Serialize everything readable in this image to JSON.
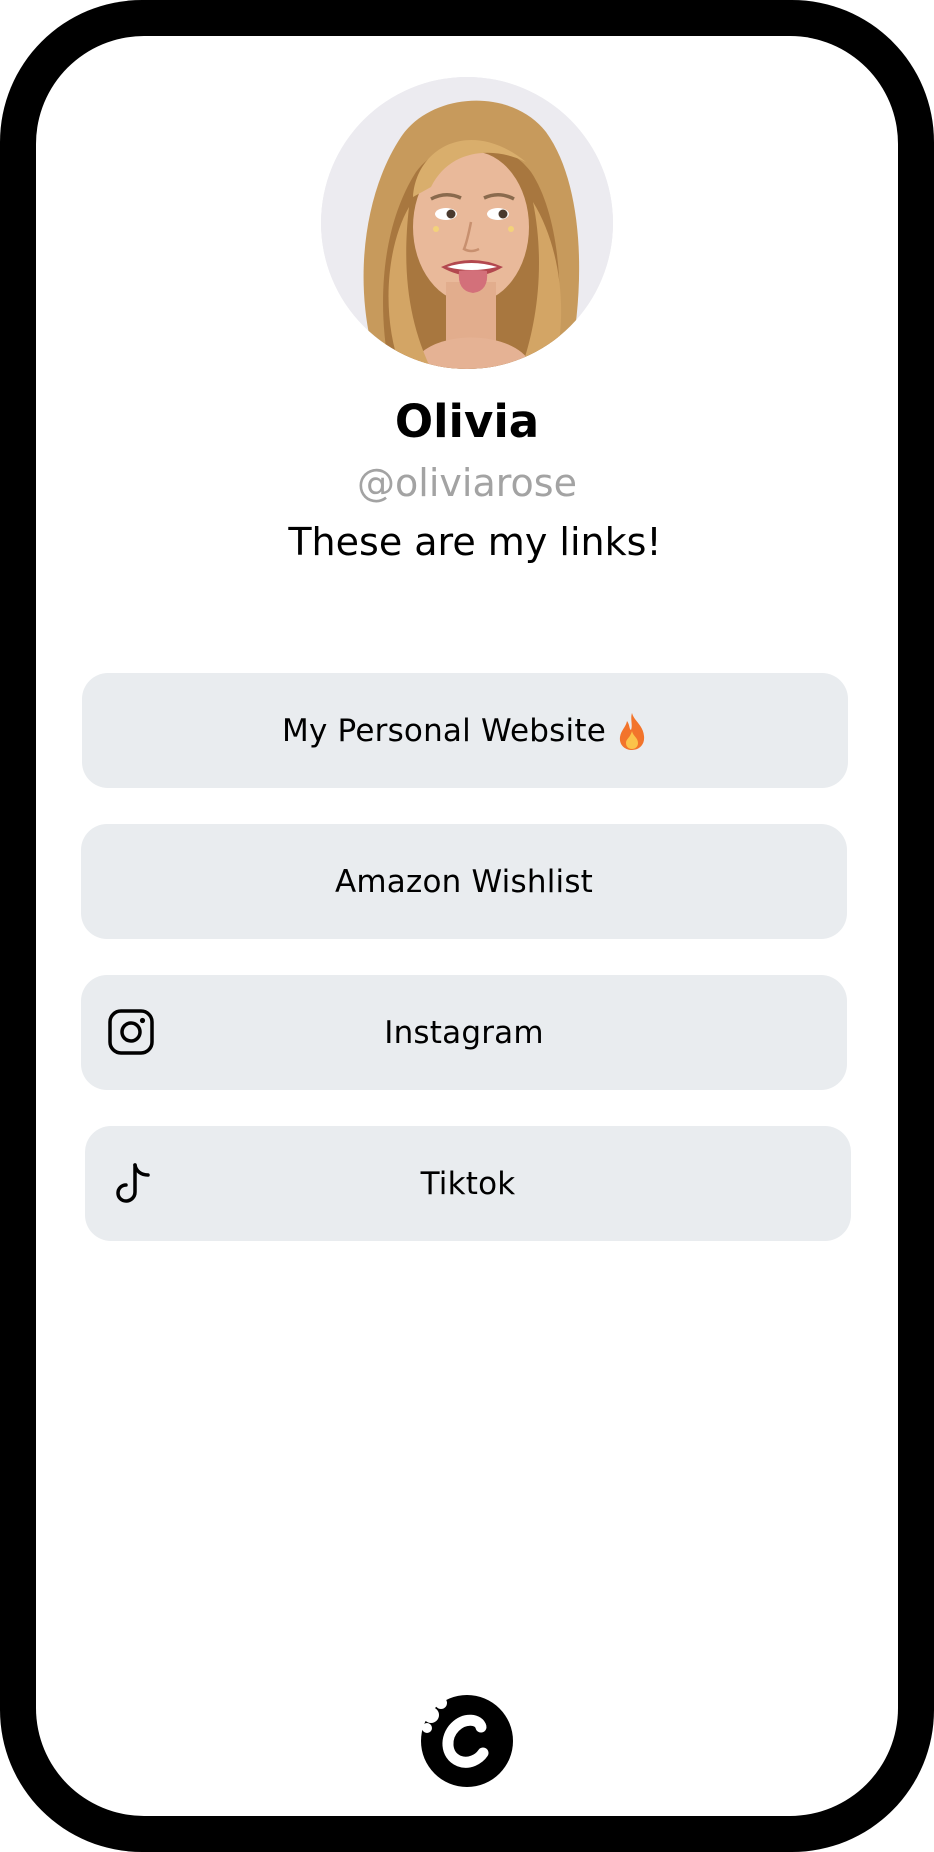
{
  "profile": {
    "name": "Olivia",
    "handle": "@oliviarose",
    "bio": "These are my links!"
  },
  "links": [
    {
      "label": "My Personal Website",
      "icon": "fire-emoji"
    },
    {
      "label": "Amazon Wishlist",
      "icon": ""
    },
    {
      "label": "Instagram",
      "icon": "instagram-icon"
    },
    {
      "label": "Tiktok",
      "icon": "tiktok-icon"
    }
  ],
  "colors": {
    "frame": "#000000",
    "screen": "#ffffff",
    "button_bg": "#e9ecef",
    "handle_text": "#a3a3a3"
  }
}
